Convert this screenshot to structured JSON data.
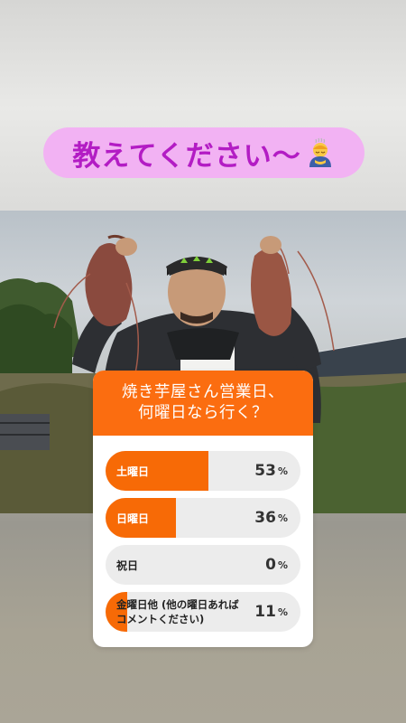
{
  "story": {
    "caption_text": "教えてください〜",
    "caption_emoji": "person-bowing-emoji",
    "photo": "man-holding-sweet-potatoes-photo"
  },
  "poll": {
    "question_line1": "焼き芋屋さん営業日、",
    "question_line2": "何曜日なら行く？",
    "accent_color": "#fb6d10",
    "options": [
      {
        "label": "土曜日",
        "percent": "53",
        "fill_fraction": 0.53
      },
      {
        "label": "日曜日",
        "percent": "36",
        "fill_fraction": 0.36
      },
      {
        "label": "祝日",
        "percent": "0",
        "fill_fraction": 0.0
      },
      {
        "label_line1": "金曜日他 (他の曜日あれば",
        "label_line2": "コメントください)",
        "percent": "11",
        "fill_fraction": 0.11
      }
    ],
    "percent_sign": "%"
  }
}
